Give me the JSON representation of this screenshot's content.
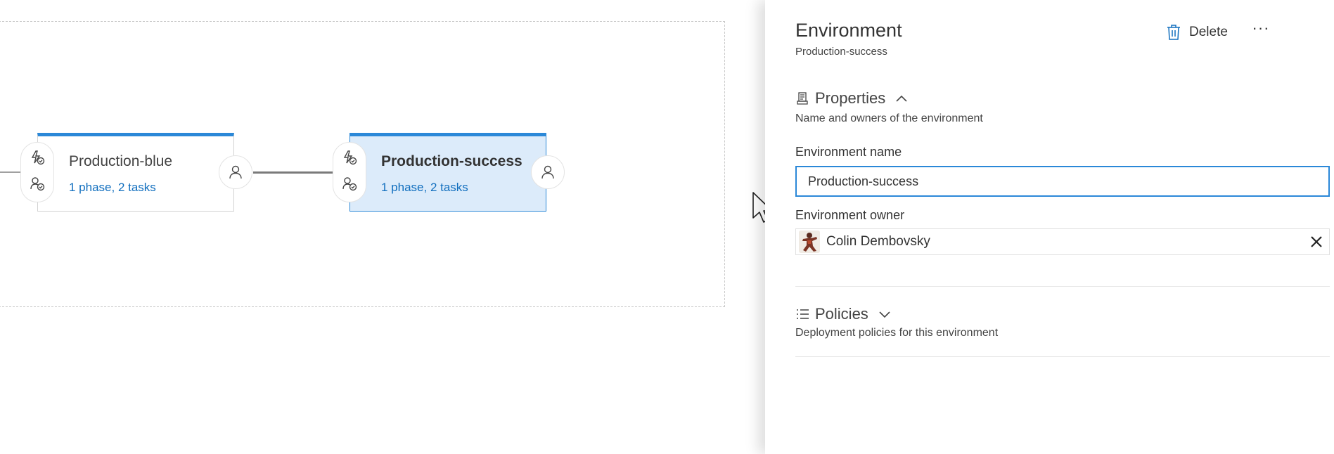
{
  "pipeline": {
    "stages": [
      {
        "name": "Production-blue",
        "summary": "1 phase, 2 tasks",
        "selected": false
      },
      {
        "name": "Production-success",
        "summary": "1 phase, 2 tasks",
        "selected": true
      }
    ],
    "accent_color": "#2b88d8",
    "selected_fill": "#dcebfa"
  },
  "panel": {
    "title": "Environment",
    "subtitle": "Production-success",
    "delete_label": "Delete",
    "more_label": "···",
    "properties": {
      "title": "Properties",
      "description": "Name and owners of the environment",
      "expanded": true,
      "icon": "properties-icon"
    },
    "fields": {
      "name_label": "Environment name",
      "name_value": "Production-success",
      "owner_label": "Environment owner",
      "owner_name": "Colin Dembovsky"
    },
    "policies": {
      "title": "Policies",
      "description": "Deployment policies for this environment",
      "expanded": false,
      "icon": "list-icon"
    }
  }
}
